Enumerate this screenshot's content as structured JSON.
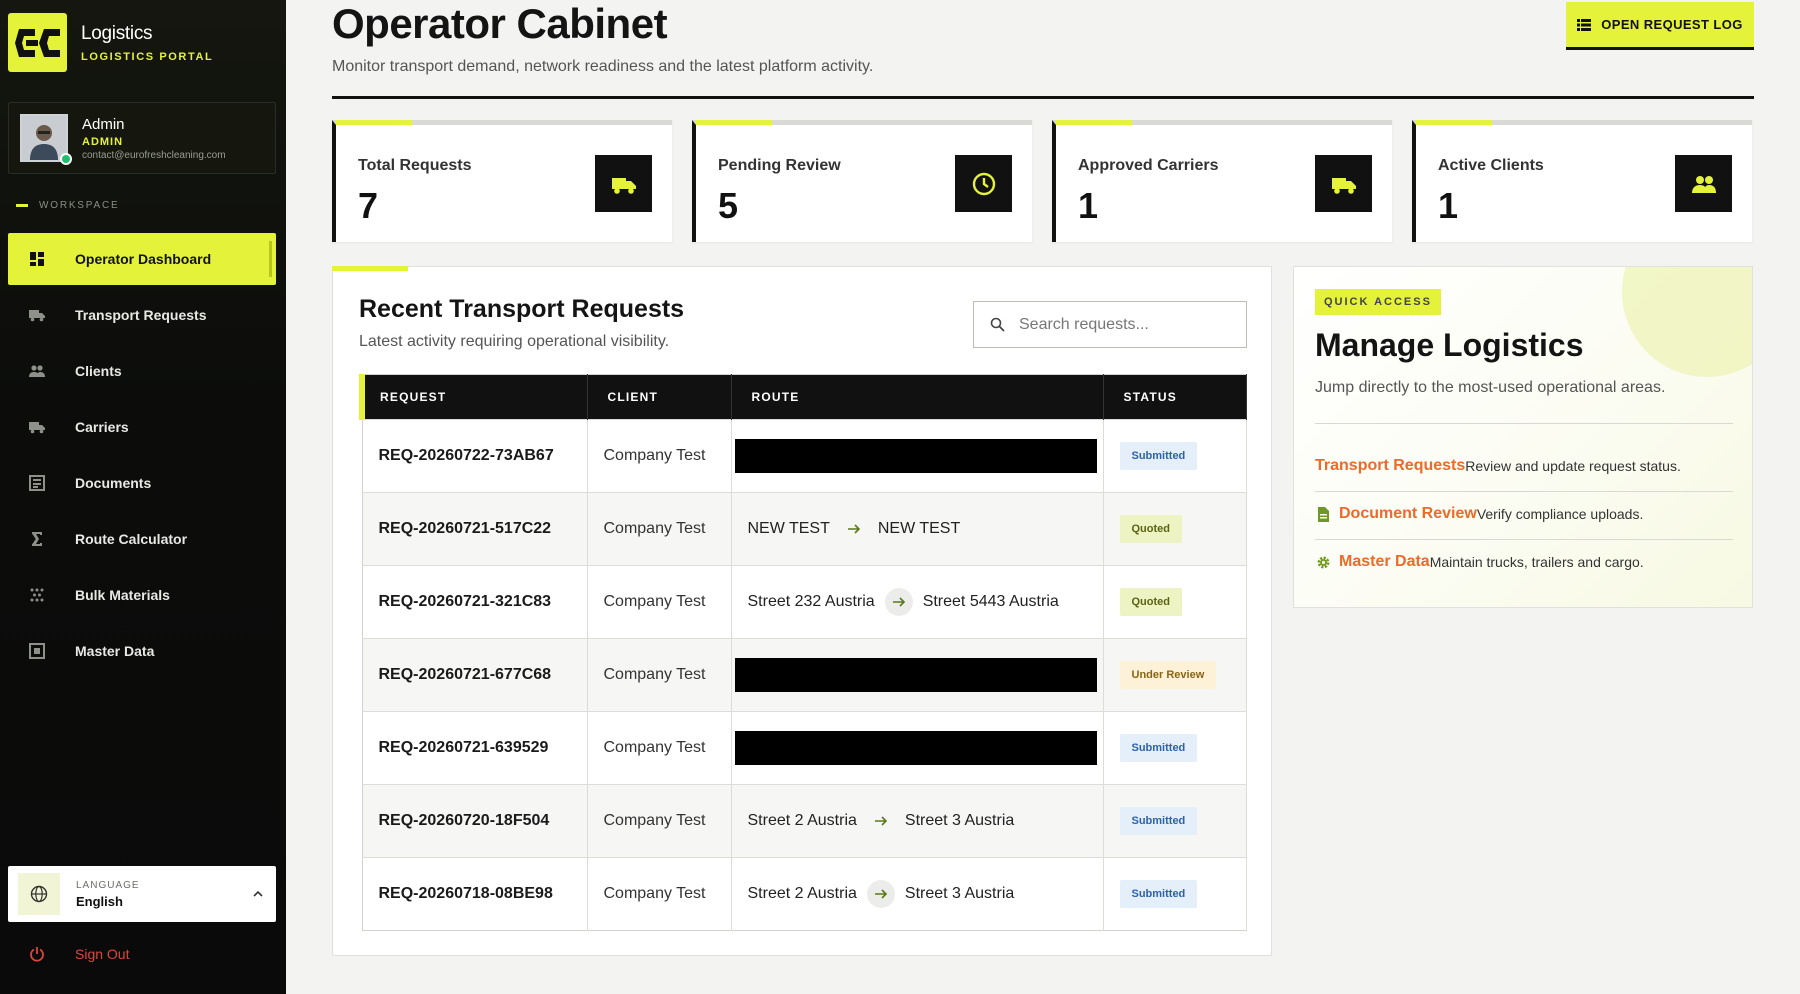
{
  "brand": {
    "title": "Logistics",
    "subtitle": "LOGISTICS PORTAL"
  },
  "user": {
    "name": "Admin",
    "role": "ADMIN",
    "email": "contact@eurofreshcleaning.com"
  },
  "sidebar": {
    "section_label": "WORKSPACE",
    "items": [
      {
        "label": "Operator Dashboard",
        "icon": "dashboard-icon",
        "active": true
      },
      {
        "label": "Transport Requests",
        "icon": "truck-icon"
      },
      {
        "label": "Clients",
        "icon": "people-icon"
      },
      {
        "label": "Carriers",
        "icon": "truck-icon"
      },
      {
        "label": "Documents",
        "icon": "document-icon"
      },
      {
        "label": "Route Calculator",
        "icon": "sigma-icon"
      },
      {
        "label": "Bulk Materials",
        "icon": "grain-icon"
      },
      {
        "label": "Master Data",
        "icon": "grid-box-icon"
      }
    ],
    "language": {
      "label": "LANGUAGE",
      "value": "English"
    },
    "signout": "Sign Out"
  },
  "header": {
    "title": "Operator Cabinet",
    "subtitle": "Monitor transport demand, network readiness and the latest platform activity.",
    "open_log_label": "OPEN REQUEST LOG"
  },
  "stats": [
    {
      "label": "Total Requests",
      "value": "7",
      "icon": "truck-icon"
    },
    {
      "label": "Pending Review",
      "value": "5",
      "icon": "clock-icon"
    },
    {
      "label": "Approved Carriers",
      "value": "1",
      "icon": "truck-icon"
    },
    {
      "label": "Active Clients",
      "value": "1",
      "icon": "people-icon"
    }
  ],
  "requests": {
    "title": "Recent Transport Requests",
    "subtitle": "Latest activity requiring operational visibility.",
    "search_placeholder": "Search requests...",
    "columns": [
      "REQUEST",
      "CLIENT",
      "ROUTE",
      "STATUS"
    ],
    "rows": [
      {
        "id": "REQ-20260722-73AB67",
        "client": "Company Test",
        "from": "",
        "to": "",
        "redacted": true,
        "status": "Submitted"
      },
      {
        "id": "REQ-20260721-517C22",
        "client": "Company Test",
        "from": "NEW TEST",
        "to": "NEW TEST",
        "redacted": false,
        "status": "Quoted"
      },
      {
        "id": "REQ-20260721-321C83",
        "client": "Company Test",
        "from": "Street 232 Austria",
        "to": "Street 5443 Austria",
        "redacted": false,
        "status": "Quoted"
      },
      {
        "id": "REQ-20260721-677C68",
        "client": "Company Test",
        "from": "",
        "to": "",
        "redacted": true,
        "status": "Under Review"
      },
      {
        "id": "REQ-20260721-639529",
        "client": "Company Test",
        "from": "",
        "to": "",
        "redacted": true,
        "status": "Submitted"
      },
      {
        "id": "REQ-20260720-18F504",
        "client": "Company Test",
        "from": "Street 2 Austria",
        "to": "Street 3 Austria",
        "redacted": false,
        "status": "Submitted"
      },
      {
        "id": "REQ-20260718-08BE98",
        "client": "Company Test",
        "from": "Street 2 Austria",
        "to": "Street 3 Austria",
        "redacted": false,
        "status": "Submitted"
      }
    ]
  },
  "quick_access": {
    "tag": "QUICK ACCESS",
    "title": "Manage Logistics",
    "subtitle": "Jump directly to the most-used operational areas.",
    "links": [
      {
        "name": "Transport Requests",
        "desc": "Review and update request status."
      },
      {
        "name": "Document Review",
        "desc": "Verify compliance uploads."
      },
      {
        "name": "Master Data",
        "desc": "Maintain trucks, trailers and cargo."
      }
    ]
  },
  "colors": {
    "accent": "#e4f23a",
    "sidebar": "#0c0d0b",
    "link": "#ec6a2a",
    "danger": "#e0453c"
  }
}
